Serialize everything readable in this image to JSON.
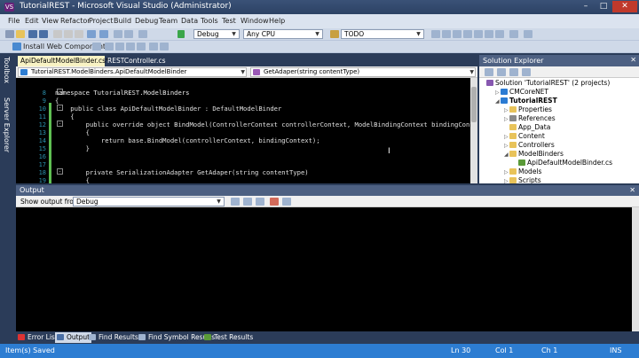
{
  "window": {
    "title": "TutorialREST - Microsoft Visual Studio (Administrator)",
    "app_icon": "VS"
  },
  "menu": [
    "File",
    "Edit",
    "View",
    "Refactor",
    "Project",
    "Build",
    "Debug",
    "Team",
    "Data",
    "Tools",
    "Test",
    "Window",
    "Help"
  ],
  "toolbar": {
    "config": "Debug",
    "platform": "Any CPU",
    "find": "TODO",
    "install_web_components": "Install Web Components"
  },
  "left_dock": [
    "Toolbox",
    "Server Explorer"
  ],
  "editor": {
    "tabs": [
      "ApiDefaultModelBinder.cs*",
      "RESTController.cs"
    ],
    "nav_type": "TutorialREST.ModelBinders.ApiDefaultModelBinder",
    "nav_member": "GetAdaper(string contentType)",
    "lines": [
      {
        "n": "8",
        "text": "namespace TutorialREST.ModelBinders"
      },
      {
        "n": "9",
        "text": "{"
      },
      {
        "n": "10",
        "text": "    public class ApiDefaultModelBinder : DefaultModelBinder"
      },
      {
        "n": "11",
        "text": "    {"
      },
      {
        "n": "12",
        "text": "        public override object BindModel(ControllerContext controllerContext, ModelBindingContext bindingContext)"
      },
      {
        "n": "13",
        "text": "        {"
      },
      {
        "n": "14",
        "text": "            return base.BindModel(controllerContext, bindingContext);"
      },
      {
        "n": "15",
        "text": "        }"
      },
      {
        "n": "16",
        "text": ""
      },
      {
        "n": "17",
        "text": ""
      },
      {
        "n": "18",
        "text": "        private SerializationAdapter GetAdaper(string contentType)"
      },
      {
        "n": "19",
        "text": "        {"
      }
    ]
  },
  "solution_explorer": {
    "title": "Solution Explorer",
    "nodes": [
      {
        "label": "Solution 'TutorialREST' (2 projects)",
        "kind": "sln"
      },
      {
        "label": "CMCoreNET",
        "kind": "proj"
      },
      {
        "label": "TutorialREST",
        "kind": "proj"
      },
      {
        "label": "Properties",
        "kind": "folder"
      },
      {
        "label": "References",
        "kind": "ref"
      },
      {
        "label": "App_Data",
        "kind": "folder"
      },
      {
        "label": "Content",
        "kind": "folder"
      },
      {
        "label": "Controllers",
        "kind": "folder"
      },
      {
        "label": "ModelBinders",
        "kind": "folder"
      },
      {
        "label": "ApiDefaultModelBinder.cs",
        "kind": "file"
      },
      {
        "label": "Models",
        "kind": "folder"
      },
      {
        "label": "Scripts",
        "kind": "folder"
      }
    ]
  },
  "output": {
    "title": "Output",
    "show_from_label": "Show output from:",
    "show_from_value": "Debug"
  },
  "bottom_tabs": [
    "Error List",
    "Output",
    "Find Results 1",
    "Find Symbol Results",
    "Test Results"
  ],
  "status": {
    "text": "Item(s) Saved",
    "ln": "Ln 30",
    "col": "Col 1",
    "ch": "Ch 1",
    "ins": "INS"
  }
}
